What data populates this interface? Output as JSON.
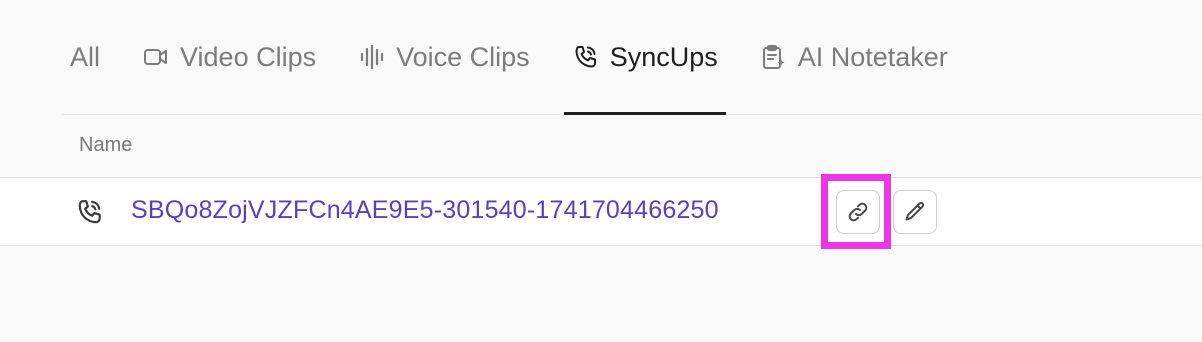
{
  "tabs": [
    {
      "label": "All",
      "icon": "none",
      "active": false
    },
    {
      "label": "Video Clips",
      "icon": "video-camera-icon",
      "active": false
    },
    {
      "label": "Voice Clips",
      "icon": "audio-waveform-icon",
      "active": false
    },
    {
      "label": "SyncUps",
      "icon": "phone-call-icon",
      "active": true
    },
    {
      "label": "AI Notetaker",
      "icon": "clipboard-ai-icon",
      "active": false
    }
  ],
  "table": {
    "columns": [
      "Name"
    ],
    "rows": [
      {
        "icon": "phone-call-icon",
        "name": "SBQo8ZojVJZFCn4AE9E5-301540-1741704466250"
      }
    ]
  },
  "actions": {
    "copy_link_icon": "link-icon",
    "edit_icon": "pencil-icon"
  },
  "colors": {
    "link": "#5a3fc4",
    "highlight": "#ee36e6",
    "active_tab": "#1f1f1f",
    "inactive_tab": "#7c7c7c"
  }
}
